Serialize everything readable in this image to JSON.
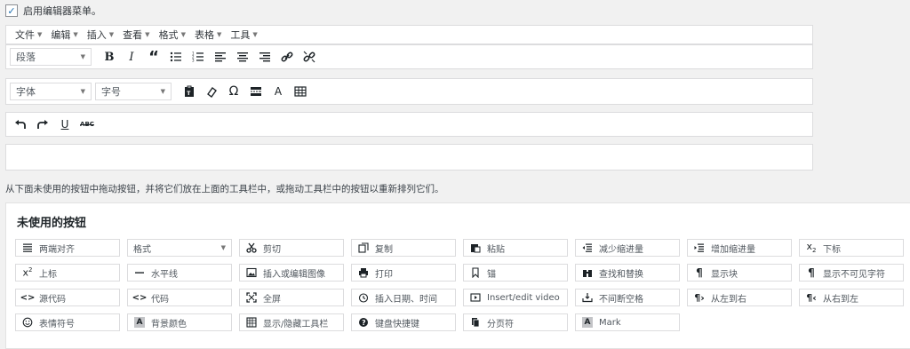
{
  "enable": {
    "label": "启用编辑器菜单。",
    "checked": true
  },
  "menubar": {
    "items": [
      "文件",
      "编辑",
      "插入",
      "查看",
      "格式",
      "表格",
      "工具"
    ]
  },
  "toolbar1": {
    "format_select": "段落"
  },
  "toolbar2": {
    "font_select": "字体",
    "size_select": "字号",
    "abc_label": "A"
  },
  "toolbar3": {
    "strike_label": "ABC"
  },
  "hint": "从下面未使用的按钮中拖动按钮，并将它们放在上面的工具栏中，或拖动工具栏中的按钮以重新排列它们。",
  "unused": {
    "title": "未使用的按钮",
    "buttons": [
      {
        "label": "两端对齐",
        "icon": "justify-icon"
      },
      {
        "label": "格式",
        "icon": "select"
      },
      {
        "label": "剪切",
        "icon": "scissors-icon"
      },
      {
        "label": "复制",
        "icon": "copy-icon"
      },
      {
        "label": "粘贴",
        "icon": "paste-icon"
      },
      {
        "label": "减少缩进量",
        "icon": "outdent-icon"
      },
      {
        "label": "增加缩进量",
        "icon": "indent-icon"
      },
      {
        "label": "下标",
        "icon": "subscript-icon"
      },
      {
        "label": "上标",
        "icon": "superscript-icon"
      },
      {
        "label": "水平线",
        "icon": "hr-icon"
      },
      {
        "label": "插入或编辑图像",
        "icon": "image-icon"
      },
      {
        "label": "打印",
        "icon": "print-icon"
      },
      {
        "label": "锚",
        "icon": "bookmark-icon"
      },
      {
        "label": "查找和替换",
        "icon": "binoculars-icon"
      },
      {
        "label": "显示块",
        "icon": "pilcrow-icon"
      },
      {
        "label": "显示不可见字符",
        "icon": "pilcrow-icon"
      },
      {
        "label": "源代码",
        "icon": "code-icon"
      },
      {
        "label": "代码",
        "icon": "code-icon"
      },
      {
        "label": "全屏",
        "icon": "fullscreen-icon"
      },
      {
        "label": "插入日期、时间",
        "icon": "clock-icon"
      },
      {
        "label": "Insert/edit video",
        "icon": "video-icon"
      },
      {
        "label": "不间断空格",
        "icon": "nbsp-icon"
      },
      {
        "label": "从左到右",
        "icon": "ltr-icon"
      },
      {
        "label": "从右到左",
        "icon": "rtl-icon"
      },
      {
        "label": "表情符号",
        "icon": "smiley-icon"
      },
      {
        "label": "背景颜色",
        "icon": "bgcolor-icon"
      },
      {
        "label": "显示/隐藏工具栏",
        "icon": "kitchen-sink-icon"
      },
      {
        "label": "键盘快捷键",
        "icon": "help-icon"
      },
      {
        "label": "分页符",
        "icon": "pagebreak-icon"
      },
      {
        "label": "Mark",
        "icon": "mark-icon"
      }
    ]
  },
  "colors": {
    "checkbox": "#2271b1",
    "border": "#dcdcde",
    "background": "#f1f1f1"
  }
}
